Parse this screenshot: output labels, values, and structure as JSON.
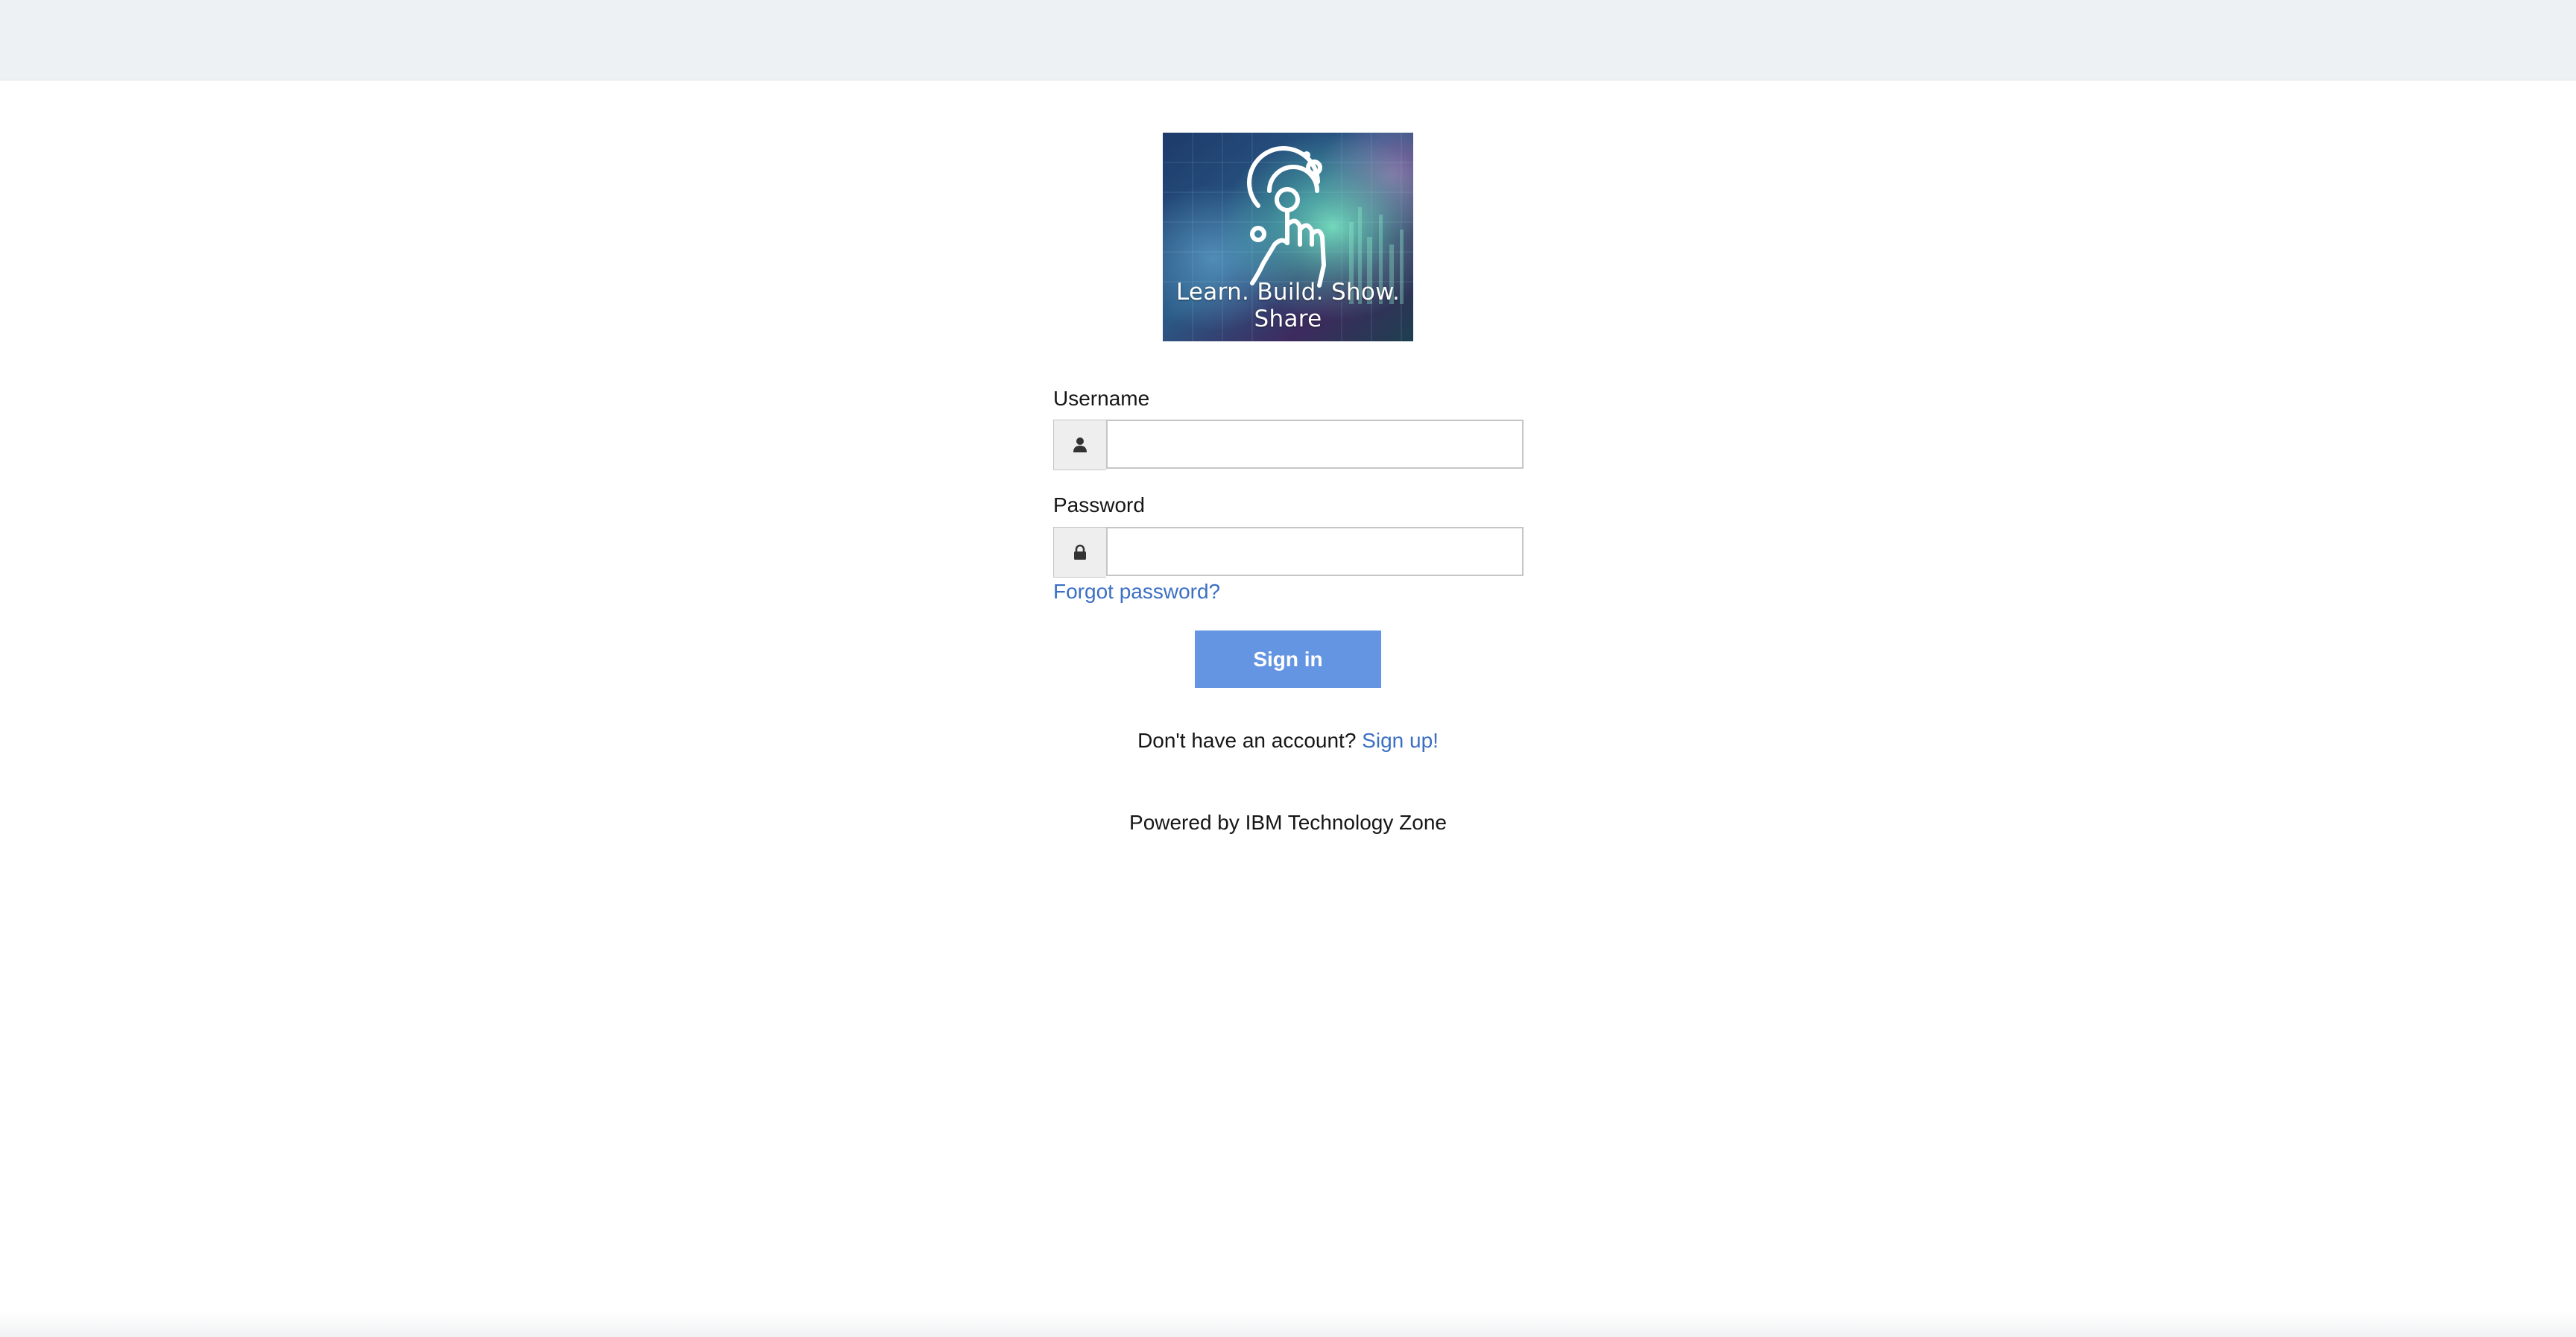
{
  "header": {
    "bar_color": "#eef1f4"
  },
  "logo": {
    "caption": "Learn. Build. Show. Share",
    "icon": "touch-target-hand-icon"
  },
  "form": {
    "username": {
      "label": "Username",
      "value": "",
      "icon": "user-icon"
    },
    "password": {
      "label": "Password",
      "value": "",
      "icon": "lock-icon"
    },
    "forgot_link": "Forgot password?",
    "submit_label": "Sign in",
    "submit_color": "#6495e2"
  },
  "signup": {
    "prompt": "Don't have an account?",
    "link": "Sign up!"
  },
  "footer": {
    "powered_by": "Powered by IBM Technology Zone"
  },
  "colors": {
    "link": "#3b6fc4"
  }
}
